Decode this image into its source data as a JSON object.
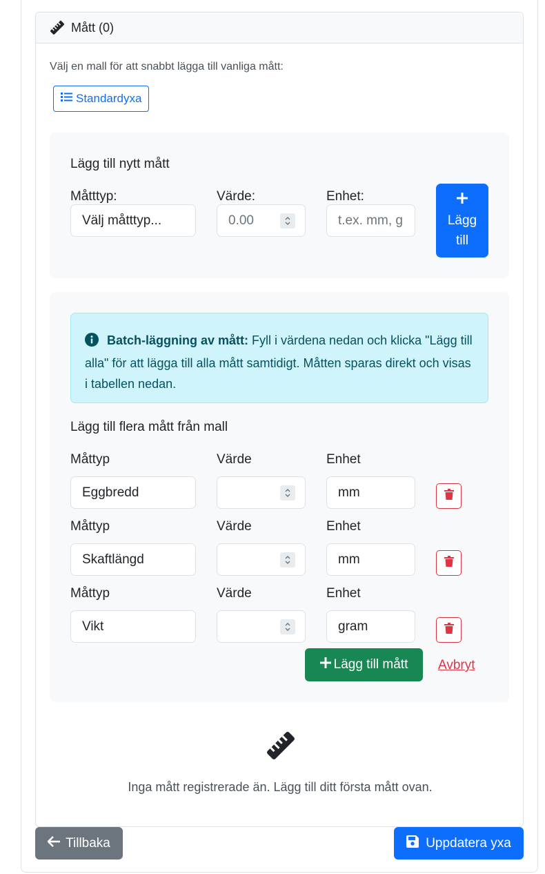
{
  "section": {
    "title": "Mått (0)",
    "hint": "Välj en mall för att snabbt lägga till vanliga mått:",
    "template_button": "Standardyxa"
  },
  "add_form": {
    "heading": "Lägg till nytt mått",
    "type_label": "Måtttyp:",
    "type_value": "Välj måtttyp...",
    "value_label": "Värde:",
    "value_placeholder": "0.00",
    "unit_label": "Enhet:",
    "unit_placeholder": "t.ex. mm, g",
    "add_button_line1": "Lägg",
    "add_button_line2": "till"
  },
  "batch": {
    "alert_title": "Batch-läggning av mått:",
    "alert_text": " Fyll i värdena nedan och klicka \"Lägg till alla\" för att lägga till alla mått samtidigt. Måtten sparas direkt och visas i tabellen nedan.",
    "heading": "Lägg till flera mått från mall",
    "col_type": "Måttyp",
    "col_value": "Värde",
    "col_unit": "Enhet",
    "rows": [
      {
        "type": "Eggbredd",
        "value": "",
        "unit": "mm"
      },
      {
        "type": "Skaftlängd",
        "value": "",
        "unit": "mm"
      },
      {
        "type": "Vikt",
        "value": "",
        "unit": "gram"
      }
    ],
    "submit_button": "Lägg till mått",
    "cancel_link": "Avbryt"
  },
  "empty_state": {
    "text": "Inga mått registrerade än. Lägg till ditt första mått ovan."
  },
  "footer": {
    "back_button": "Tillbaka",
    "save_button": "Uppdatera yxa"
  },
  "colors": {
    "primary": "#0d6efd",
    "success": "#198754",
    "danger": "#dc3545",
    "secondary": "#6c757d",
    "info_bg": "#cff4fc"
  }
}
